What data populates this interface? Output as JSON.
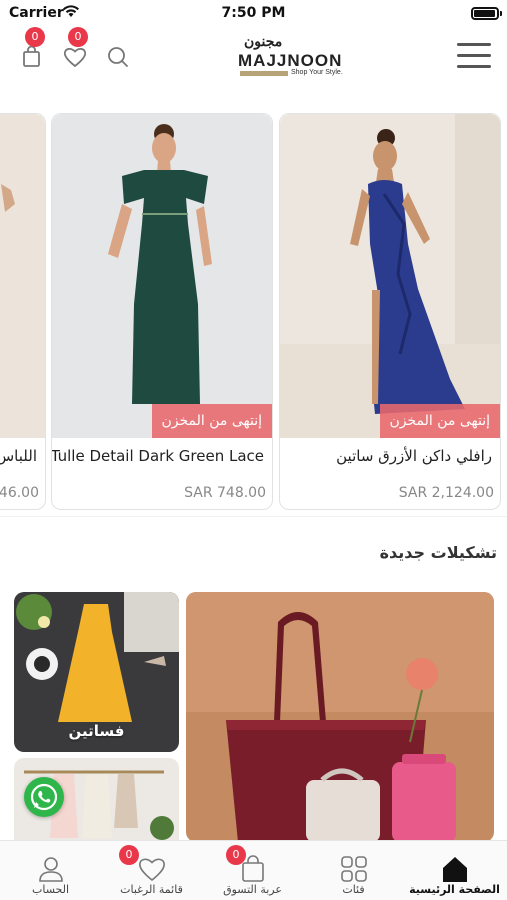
{
  "status_bar": {
    "carrier": "Carrier",
    "time": "7:50 PM"
  },
  "header": {
    "cart_count": "0",
    "wishlist_count": "0",
    "logo": {
      "arabic": "مجنون",
      "english": "MAJJNOON",
      "tagline": "Shop Your Style."
    }
  },
  "products": [
    {
      "title": "رافلي داكن الأزرق ساتين",
      "price": "SAR 2,124.00",
      "status": "إنتهى من المخزن"
    },
    {
      "title": "Tulle Detail Dark Green Lace",
      "price": "SAR 748.00",
      "status": "إنتهى من المخزن"
    },
    {
      "title": "اللباس",
      "price": "46.00",
      "status": ""
    }
  ],
  "new_collections": {
    "title": "تشكيلات جديدة",
    "tiles": [
      {
        "label": "فساتين"
      }
    ]
  },
  "tabbar": {
    "items": [
      {
        "label": "الصفحة الرئيسية",
        "icon": "home-icon",
        "active": true
      },
      {
        "label": "فئات",
        "icon": "grid-icon"
      },
      {
        "label": "عربة التسوق",
        "icon": "shopping-bag-icon",
        "badge": "0"
      },
      {
        "label": "قائمة الرغبات",
        "icon": "heart-icon",
        "badge": "0"
      },
      {
        "label": "الحساب",
        "icon": "user-icon"
      }
    ]
  },
  "colors": {
    "badge": "#e8384a",
    "stock_label": "#e8686c",
    "logo_accent": "#b8a27a",
    "whatsapp": "#2fb64a"
  }
}
